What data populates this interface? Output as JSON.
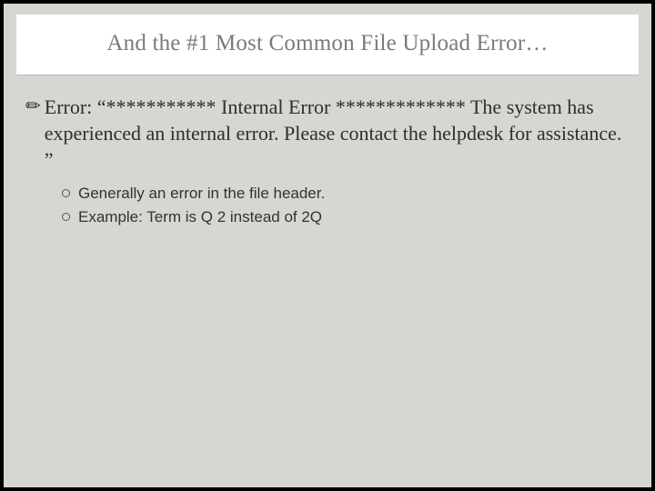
{
  "slide": {
    "title": "And the #1 Most Common File Upload Error…",
    "main_bullet_icon": "✏",
    "main_bullet_text": "Error: “*********** Internal Error ************* The system has experienced an internal error. Please contact the helpdesk for assistance. ”",
    "sub_bullets": [
      "Generally an error in the file header.",
      "Example: Term is Q 2 instead of 2Q"
    ]
  }
}
